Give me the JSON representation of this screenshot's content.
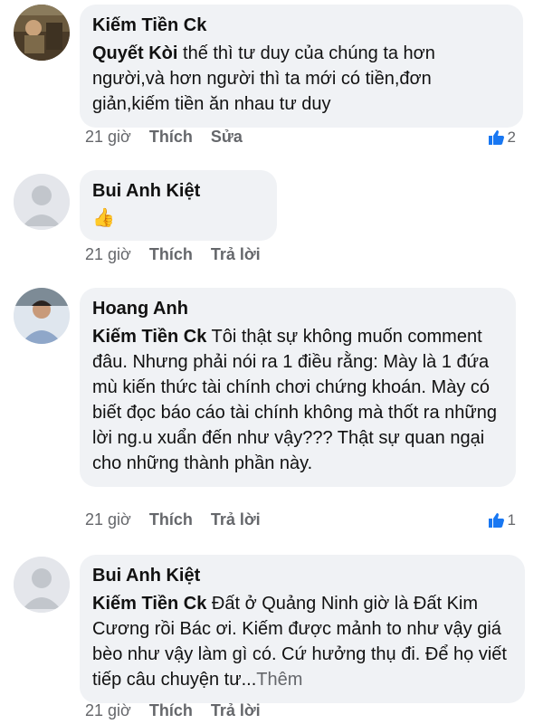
{
  "comments": [
    {
      "author": "Kiếm Tiền Ck",
      "mention": "Quyết Kòi",
      "text": " thế thì tư duy của chúng ta hơn người,và hơn người thì ta mới có tiền,đơn giản,kiếm tiền ăn nhau tư duy",
      "time": "21 giờ",
      "like_label": "Thích",
      "second_action": "Sửa",
      "reaction_count": "2"
    },
    {
      "author": "Bui Anh Kiệt",
      "emoji": "👍",
      "time": "21 giờ",
      "like_label": "Thích",
      "second_action": "Trả lời"
    },
    {
      "author": "Hoang Anh",
      "mention": "Kiếm Tiền Ck",
      "text": " Tôi thật sự không muốn comment đâu. Nhưng phải nói ra 1 điều rằng: Mày là 1 đứa mù kiến thức tài chính chơi chứng khoán. Mày có biết đọc báo cáo tài chính không mà thốt ra những lời ng.u xuẩn đến như vậy??? Thật sự quan ngại cho những thành phần này.",
      "time": "21 giờ",
      "like_label": "Thích",
      "second_action": "Trả lời",
      "reaction_count": "1"
    },
    {
      "author": "Bui Anh Kiệt",
      "mention": "Kiếm Tiền Ck",
      "text": " Đất ở Quảng Ninh giờ là Đất Kim Cương rồi Bác ơi. Kiếm được mảnh to như vậy giá bèo như vậy làm gì có. Cứ hưởng thụ đi. Để họ viết tiếp câu chuyện tư...",
      "more_label": "Thêm",
      "time": "21 giờ",
      "like_label": "Thích",
      "second_action": "Trả lời"
    }
  ],
  "colors": {
    "bubble": "#f0f2f5",
    "like_blue": "#1877f2",
    "meta_gray": "#65676b"
  }
}
